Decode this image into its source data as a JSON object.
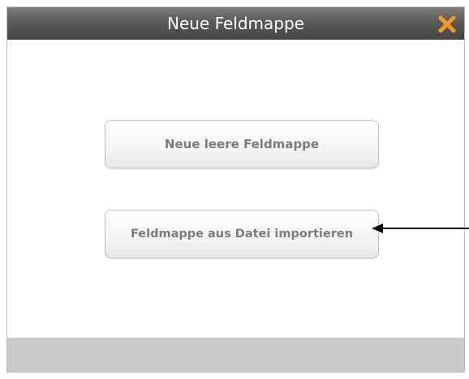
{
  "dialog": {
    "title": "Neue Feldmappe",
    "close_icon": "close-x-icon",
    "buttons": {
      "new_label": "Neue leere Feldmappe",
      "import_label": "Feldmappe aus Datei importieren"
    }
  },
  "annotation": {
    "arrow_icon": "arrow-left-icon"
  },
  "colors": {
    "titlebar": "#4f4f4f",
    "close_icon": "#f39a1e",
    "button_text": "#7c7c7c",
    "footer": "#c9c9c9"
  }
}
